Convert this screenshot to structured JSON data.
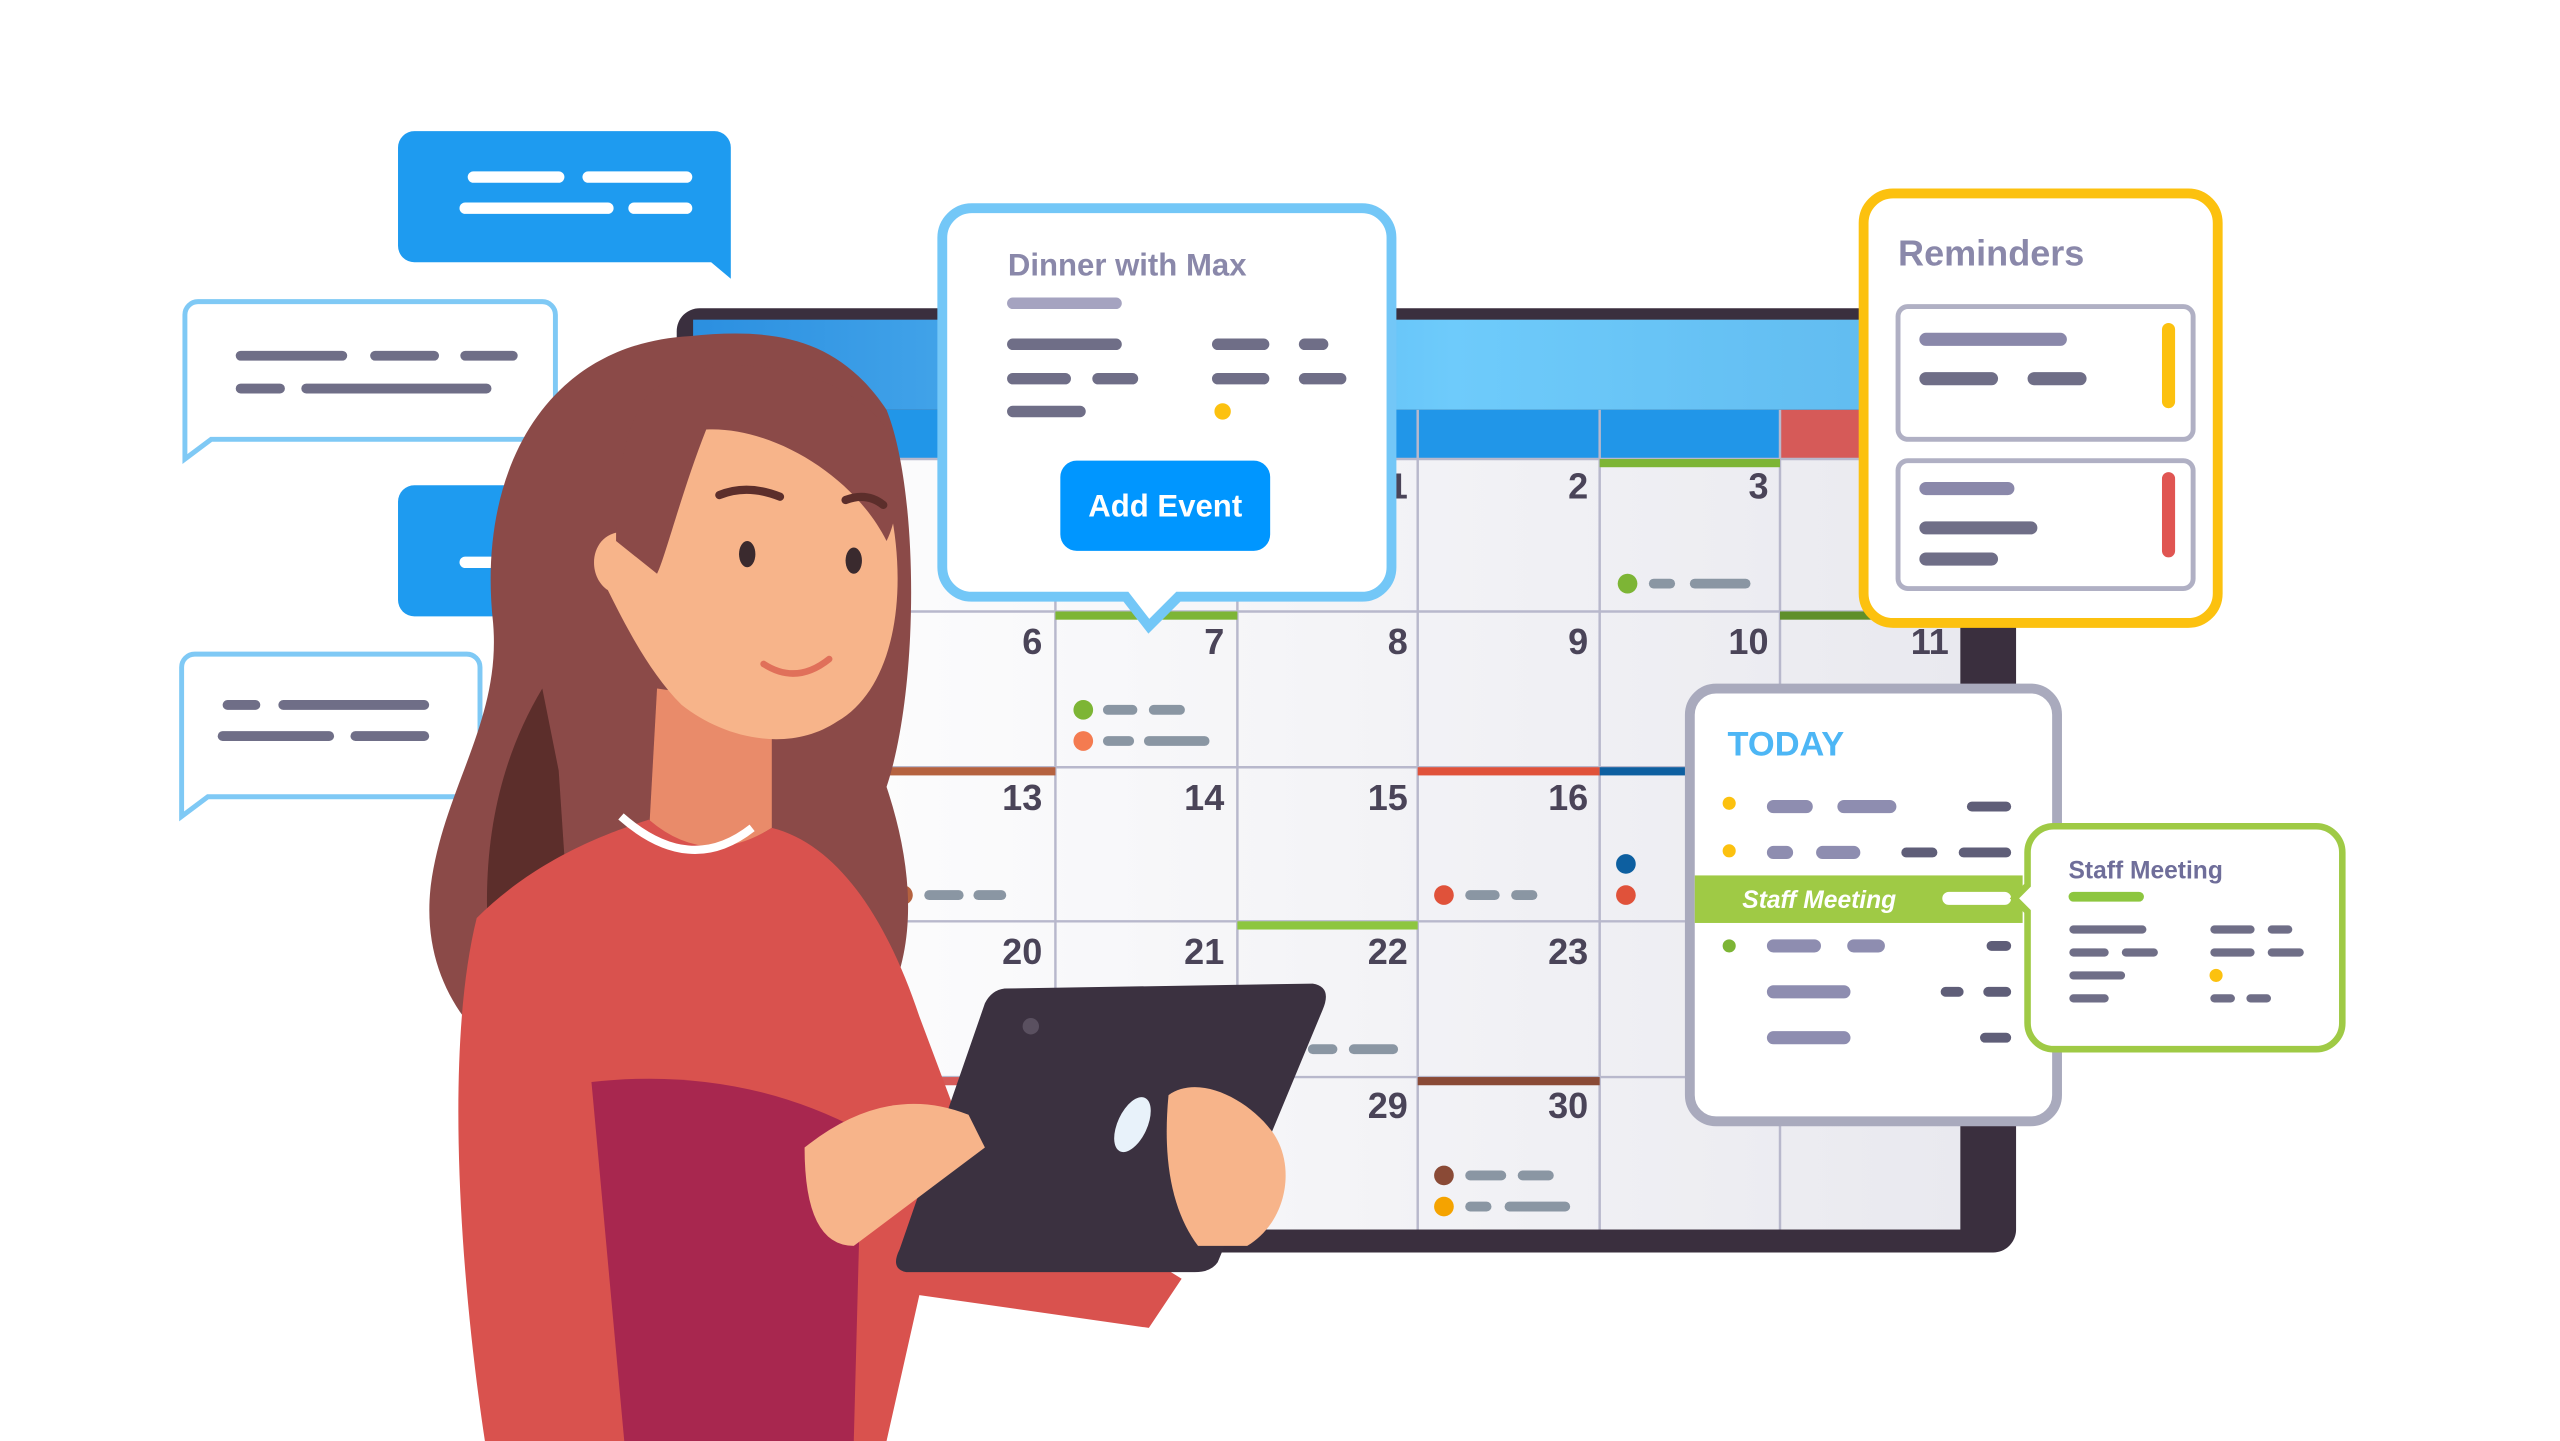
{
  "calendar": {
    "days": [
      "1",
      "2",
      "3",
      "6",
      "7",
      "8",
      "9",
      "10",
      "11",
      "13",
      "14",
      "15",
      "16",
      "20",
      "21",
      "22",
      "23",
      "29",
      "30"
    ]
  },
  "dinner_card": {
    "title": "Dinner with Max",
    "add_event_label": "Add Event"
  },
  "reminders": {
    "title": "Reminders",
    "items": [
      {
        "accent": "#fcc10f"
      },
      {
        "accent": "#e05552"
      }
    ]
  },
  "today_panel": {
    "title": "TODAY",
    "highlight_event": "Staff Meeting"
  },
  "event_detail": {
    "title": "Staff Meeting"
  },
  "colors": {
    "chat_blue": "#1e9bf0",
    "chat_outline": "#7fc9f5",
    "add_event_button": "#0096ff",
    "reminders_border": "#fcc10f",
    "staff_meeting_green": "#8dc63f",
    "today_title": "#4db6f5",
    "muted_text": "#8a88aa"
  }
}
